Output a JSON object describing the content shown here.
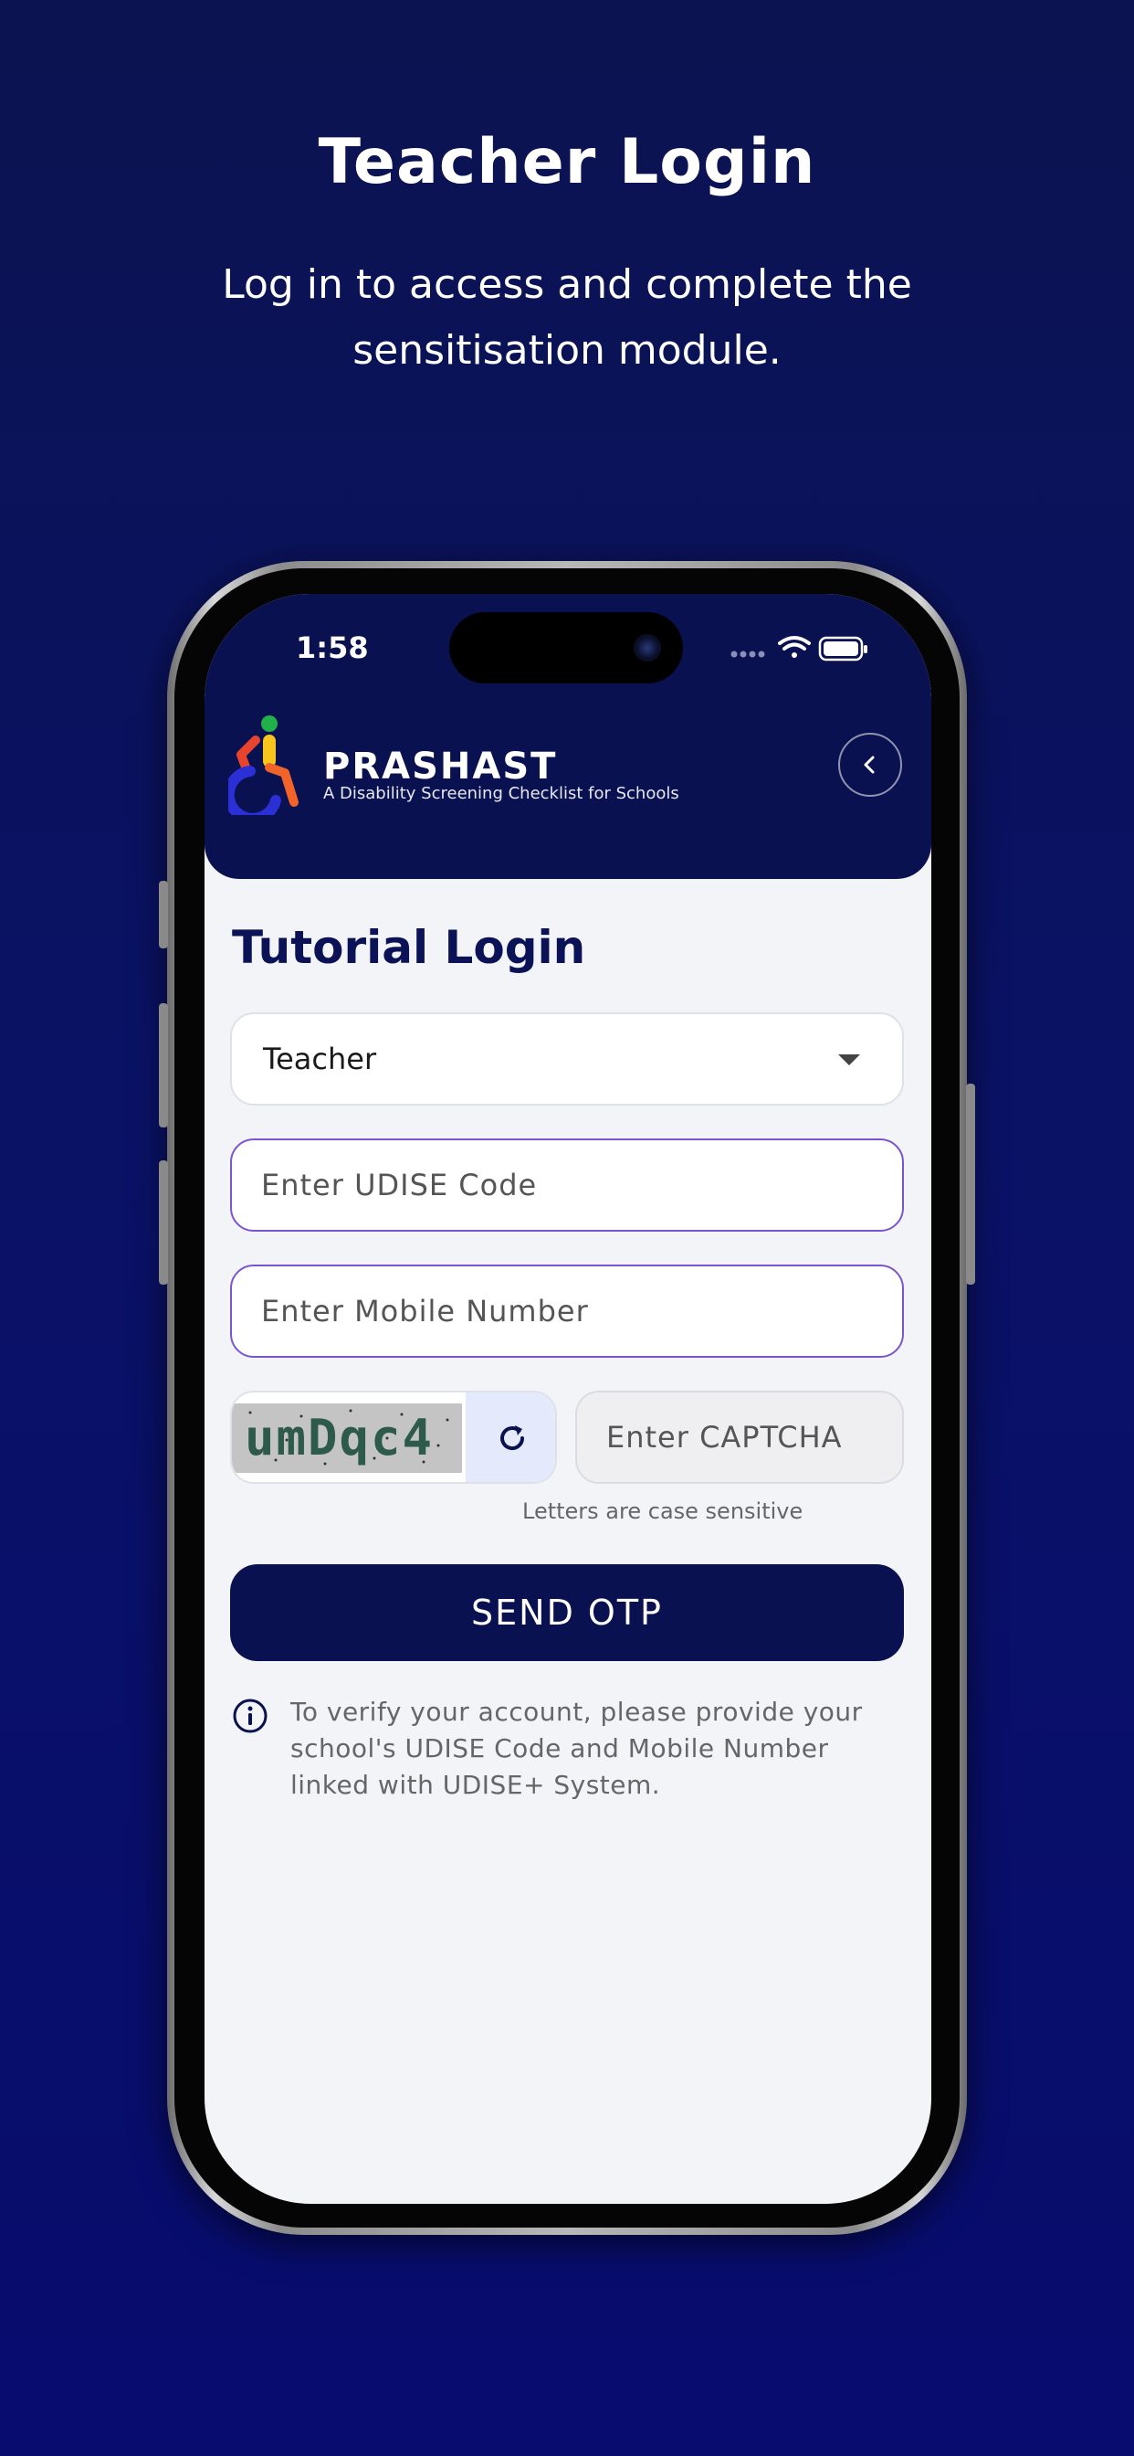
{
  "promo": {
    "title": "Teacher Login",
    "subtitle": "Log in to access and complete the sensitisation module."
  },
  "status_bar": {
    "time": "1:58"
  },
  "header": {
    "brand_name": "PRASHAST",
    "brand_tagline": "A Disability Screening Checklist for Schools"
  },
  "form": {
    "title": "Tutorial Login",
    "role_selected": "Teacher",
    "udise_placeholder": "Enter UDISE Code",
    "mobile_placeholder": "Enter Mobile Number",
    "captcha_text": "umDqc4",
    "captcha_placeholder": "Enter CAPTCHA",
    "captcha_hint": "Letters are case sensitive",
    "submit_label": "SEND OTP",
    "info_text": "To verify your account, please provide your school's UDISE Code and Mobile Number linked with UDISE+ System."
  },
  "colors": {
    "header_bg": "#0a1150",
    "input_border": "#7b55d0",
    "primary": "#0a1150",
    "screen_bg": "#f3f4f8"
  }
}
